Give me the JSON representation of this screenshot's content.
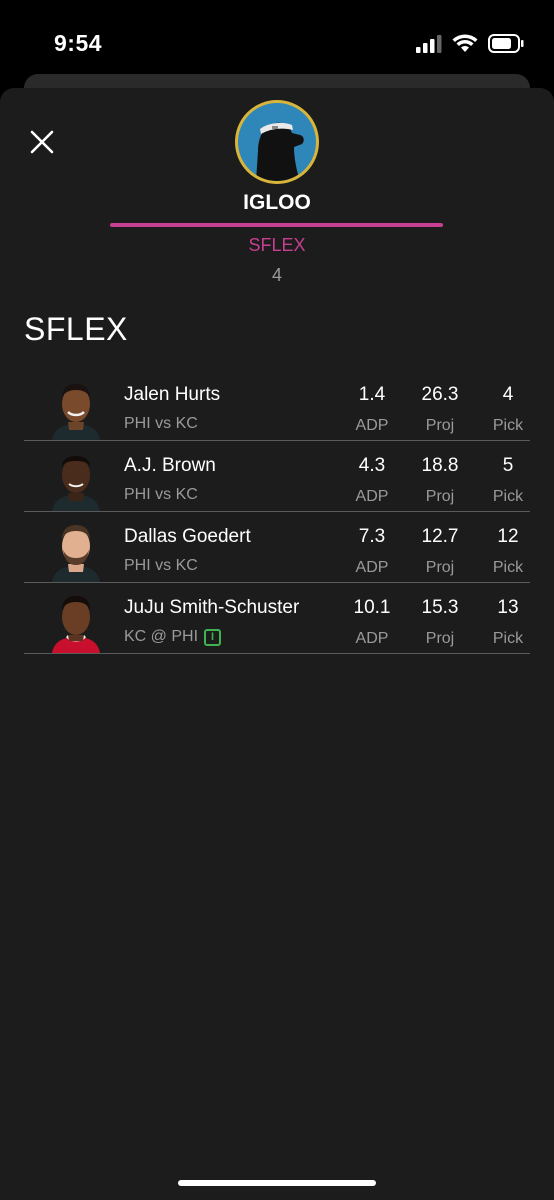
{
  "status_bar": {
    "time": "9:54"
  },
  "team": {
    "name": "IGLOO",
    "position": "SFLEX",
    "count": "4"
  },
  "section": {
    "title": "SFLEX"
  },
  "players": [
    {
      "name": "Jalen Hurts",
      "matchup": "PHI vs KC",
      "adp": "1.4",
      "adp_label": "ADP",
      "proj": "26.3",
      "proj_label": "Proj",
      "pick": "4",
      "pick_label": "Pick",
      "injury": ""
    },
    {
      "name": "A.J. Brown",
      "matchup": "PHI vs KC",
      "adp": "4.3",
      "adp_label": "ADP",
      "proj": "18.8",
      "proj_label": "Proj",
      "pick": "5",
      "pick_label": "Pick",
      "injury": ""
    },
    {
      "name": "Dallas Goedert",
      "matchup": "PHI vs KC",
      "adp": "7.3",
      "adp_label": "ADP",
      "proj": "12.7",
      "proj_label": "Proj",
      "pick": "12",
      "pick_label": "Pick",
      "injury": ""
    },
    {
      "name": "JuJu Smith-Schuster",
      "matchup": "KC @ PHI",
      "adp": "10.1",
      "adp_label": "ADP",
      "proj": "15.3",
      "proj_label": "Proj",
      "pick": "13",
      "pick_label": "Pick",
      "injury": "I"
    }
  ],
  "colors": {
    "accent": "#c63f92",
    "avatar_bg": "#2f86b9",
    "avatar_ring": "#d8b53a",
    "injury": "#3fb34f",
    "sheet_bg": "#1c1c1c"
  },
  "icons": {
    "close": "close-icon",
    "signal": "signal-icon",
    "wifi": "wifi-icon",
    "battery": "battery-icon"
  }
}
